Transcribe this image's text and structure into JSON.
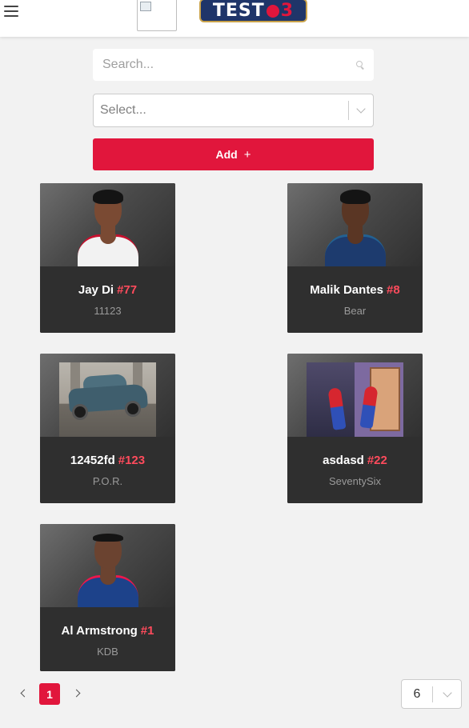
{
  "header": {
    "logo_text_main": "TEST",
    "logo_text_num": "3"
  },
  "search": {
    "placeholder": "Search..."
  },
  "filter": {
    "placeholder": "Select..."
  },
  "add_button": {
    "label": "Add",
    "icon": "plus-icon",
    "plus": "+"
  },
  "players": [
    {
      "name": "Jay Di",
      "number": "#77",
      "team": "11123",
      "picture": "portrait",
      "skin": "#7a4a33",
      "jersey": "#f2f2f2",
      "trim": "#c8102e"
    },
    {
      "name": "Malik Dantes",
      "number": "#8",
      "team": "Bear",
      "picture": "portrait",
      "skin": "#5a3624",
      "jersey": "#1d3b6e",
      "trim": "#236192"
    },
    {
      "name": "12452fd",
      "number": "#123",
      "team": "P.O.R.",
      "picture": "car-photo"
    },
    {
      "name": "asdasd",
      "number": "#22",
      "team": "SeventySix",
      "picture": "spiderman-meme"
    },
    {
      "name": "Al Armstrong",
      "number": "#1",
      "team": "KDB",
      "picture": "portrait",
      "skin": "#6b4330",
      "jersey": "#1d428a",
      "trim": "#ed174c"
    }
  ],
  "pagination": {
    "current_page": "1",
    "page_size": "6"
  },
  "colors": {
    "accent": "#e1163c",
    "number": "#ff4b5c",
    "card_bg": "#2f2f2f",
    "page_bg": "#f2f2f2"
  }
}
